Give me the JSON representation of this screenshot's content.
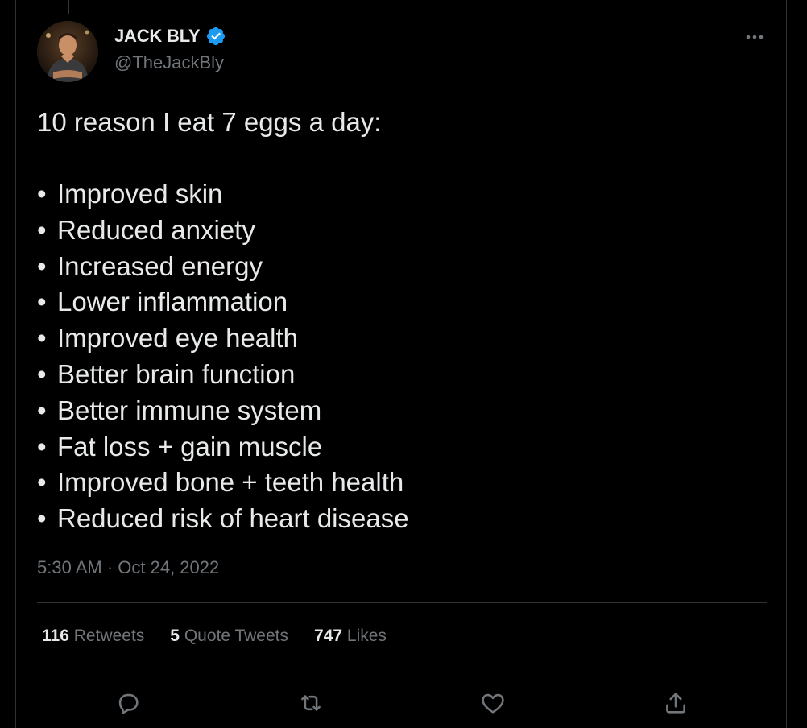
{
  "tweet": {
    "author": {
      "display_name": "JACK BLY",
      "handle": "@TheJackBly",
      "verified": true
    },
    "heading": "10 reason I eat 7 eggs a day:",
    "bullet_char": "•",
    "bullets": [
      "Improved skin",
      "Reduced anxiety",
      "Increased energy",
      "Lower inflammation",
      "Improved eye health",
      "Better brain function",
      "Better immune system",
      "Fat loss + gain muscle",
      "Improved bone + teeth health",
      "Reduced risk of heart disease"
    ],
    "timestamp": "5:30 AM · Oct 24, 2022"
  },
  "stats": {
    "retweets": {
      "count": "116",
      "label": "Retweets"
    },
    "quote_tweets": {
      "count": "5",
      "label": "Quote Tweets"
    },
    "likes": {
      "count": "747",
      "label": "Likes"
    }
  },
  "actions": [
    "reply-icon",
    "retweet-icon",
    "like-icon",
    "share-icon"
  ],
  "icons": {
    "more": "more-icon",
    "verified": "verified-badge-icon"
  },
  "colors": {
    "background": "#000000",
    "text_primary": "#e7e9ea",
    "text_secondary": "#71767b",
    "divider": "#2f3336",
    "verified_blue": "#1d9bf0"
  }
}
